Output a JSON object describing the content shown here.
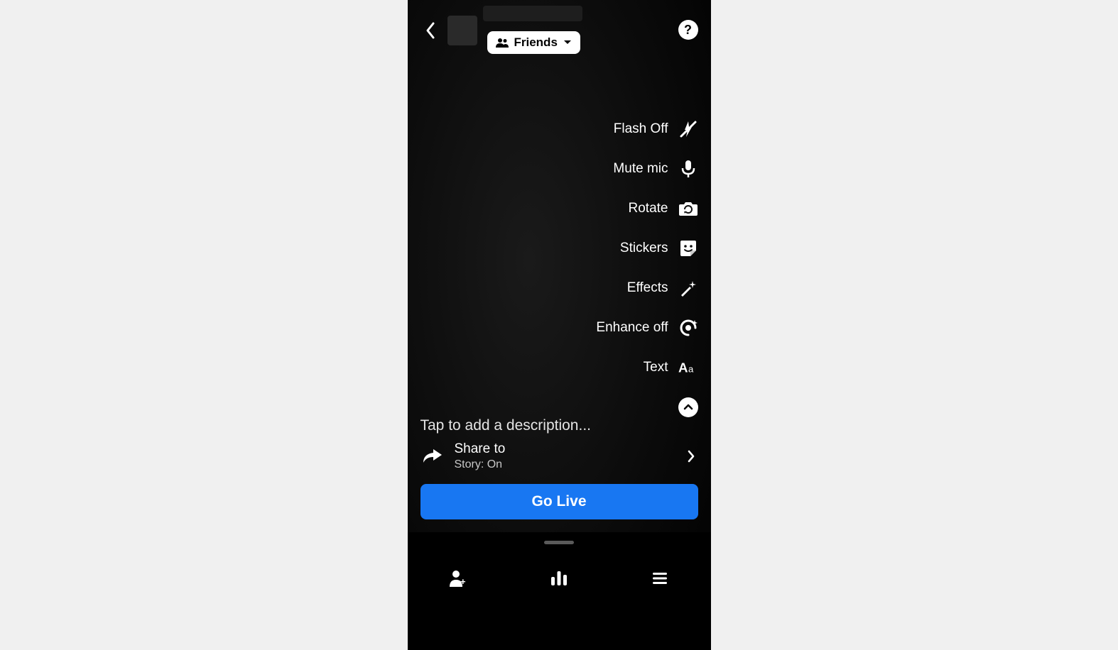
{
  "header": {
    "audience_label": "Friends"
  },
  "options": {
    "flash": "Flash Off",
    "mute": "Mute mic",
    "rotate": "Rotate",
    "stickers": "Stickers",
    "effects": "Effects",
    "enhance": "Enhance off",
    "text": "Text"
  },
  "description_placeholder": "Tap to add a description...",
  "share": {
    "title": "Share to",
    "subtitle": "Story: On"
  },
  "go_live_label": "Go Live",
  "help_label": "?"
}
